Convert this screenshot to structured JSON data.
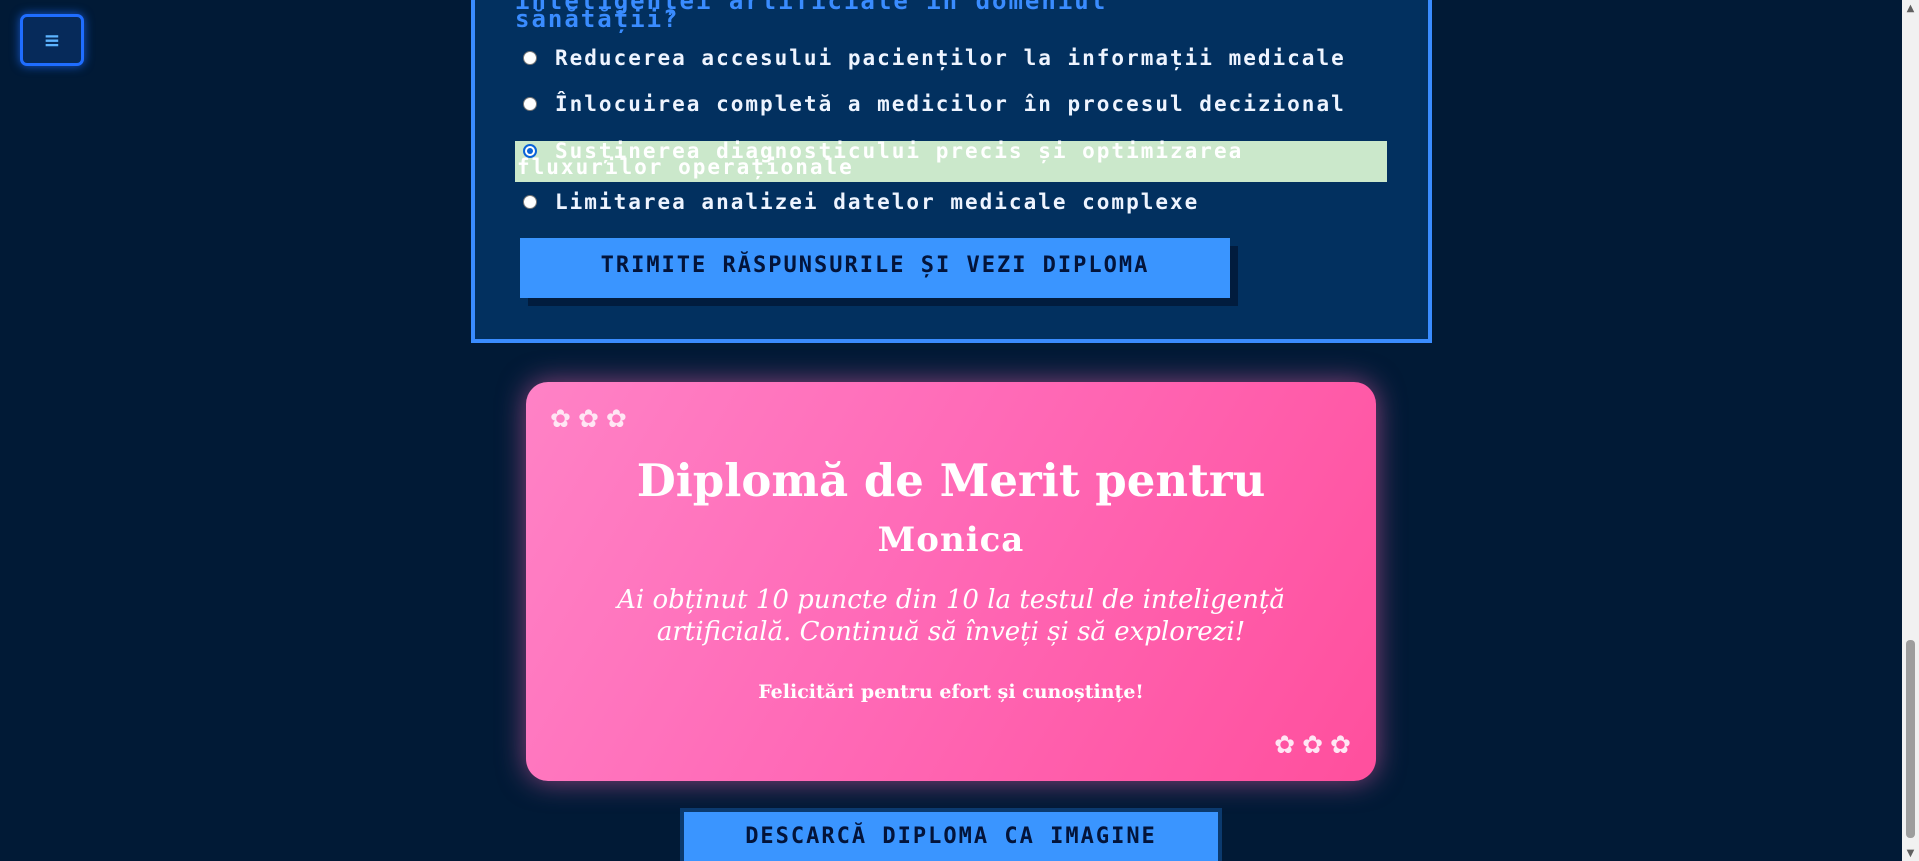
{
  "menu": {
    "icon_glyph": "≡"
  },
  "quiz": {
    "question_partial": "inteligenței artificiale în domeniul\nsănătății?",
    "options": [
      {
        "label": "Reducerea accesului pacienților la informații medicale",
        "selected": false
      },
      {
        "label": "Înlocuirea completă a medicilor în procesul decizional",
        "selected": false
      },
      {
        "label": "Susținerea diagnosticului precis și optimizarea fluxurilor operaționale",
        "selected": true
      },
      {
        "label": "Limitarea analizei datelor medicale complexe",
        "selected": false
      }
    ],
    "submit_label": "TRIMITE RĂSPUNSURILE ȘI VEZI DIPLOMA"
  },
  "diploma": {
    "title": "Diplomă de Merit pentru",
    "name": "Monica",
    "message": "Ai obținut 10 puncte din 10 la testul de inteligență artificială. Continuă să înveți și să explorezi!",
    "congrats": "Felicitări pentru efort și cunoștințe!",
    "flowers_top": "✿✿✿",
    "flowers_bottom": "✿✿✿",
    "score": 10,
    "max_score": 10
  },
  "download_label": "DESCARCĂ DIPLOMA CA IMAGINE",
  "colors": {
    "page_bg": "#011a36",
    "quiz_bg": "#02305f",
    "accent_blue": "#3a95ff",
    "selected_option_bg": "#cbe8cb",
    "diploma_pink": "#ff6ab7"
  },
  "scrollbar": {
    "up_glyph": "▲",
    "down_glyph": "▼"
  }
}
